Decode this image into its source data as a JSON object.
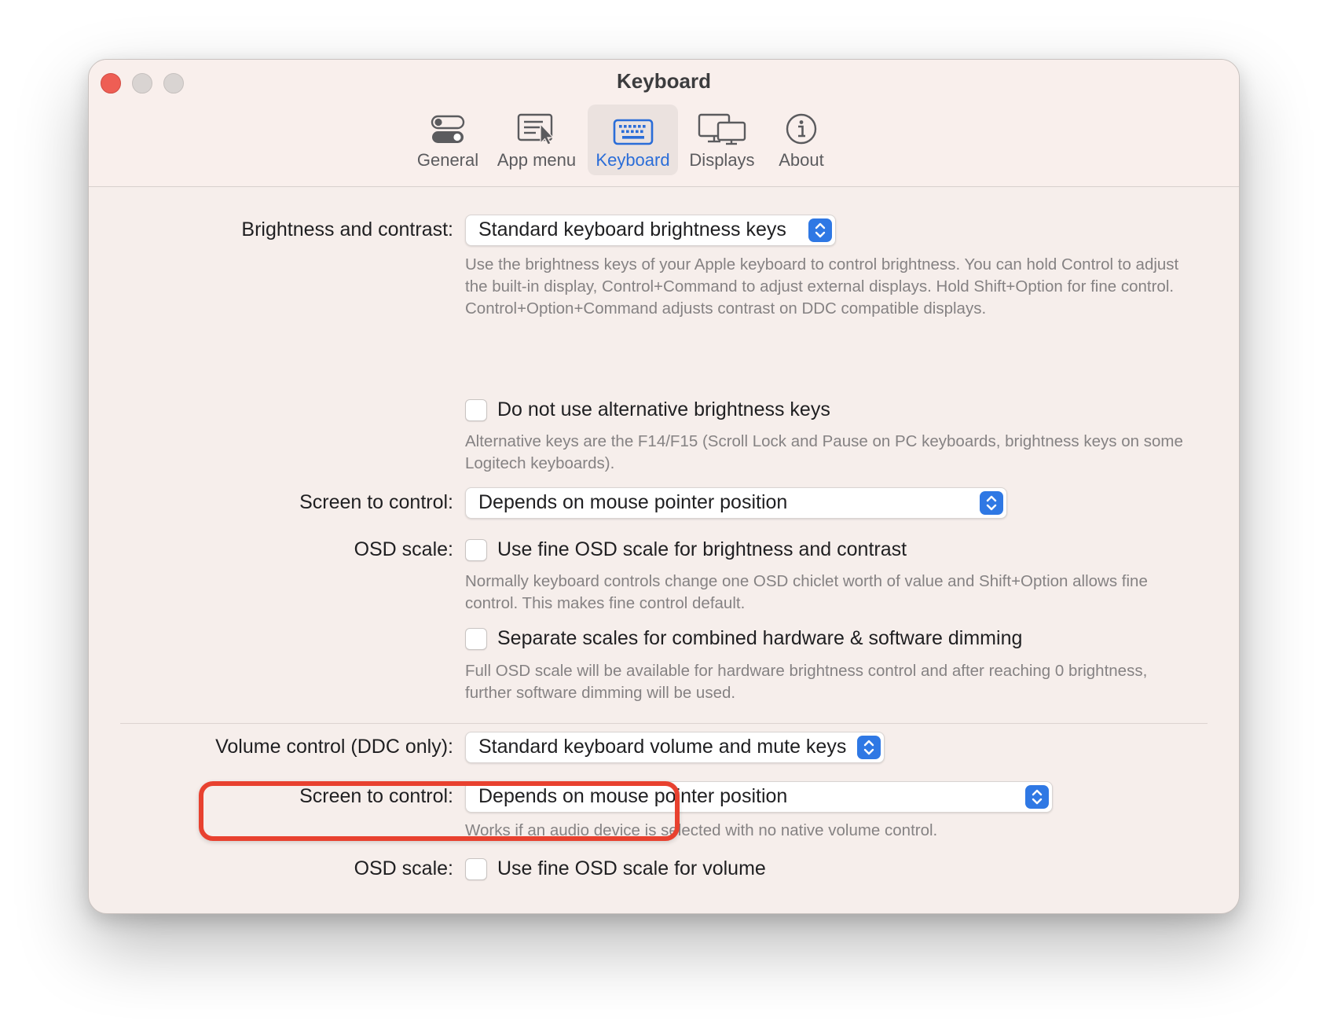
{
  "window": {
    "title": "Keyboard"
  },
  "tabs": [
    {
      "label": "General",
      "icon": "toggles-icon"
    },
    {
      "label": "App menu",
      "icon": "menu-cursor-icon"
    },
    {
      "label": "Keyboard",
      "icon": "keyboard-icon",
      "selected": true
    },
    {
      "label": "Displays",
      "icon": "displays-icon"
    },
    {
      "label": "About",
      "icon": "info-icon"
    }
  ],
  "colors": {
    "accent": "#2f78e4",
    "highlight": "#e8412f",
    "window_bg": "#f6eeeb"
  },
  "brightness": {
    "label": "Brightness and contrast:",
    "value": "Standard keyboard brightness keys",
    "description": "Use the brightness keys of your Apple keyboard to control brightness. You can hold Control to adjust the built-in display, Control+Command to adjust external displays. Hold Shift+Option for fine control. Control+Option+Command adjusts contrast on DDC compatible displays.",
    "alt_keys": {
      "label": "Do not use alternative brightness keys",
      "checked": false,
      "description": "Alternative keys are the F14/F15 (Scroll Lock and Pause on PC keyboards, brightness keys on some Logitech keyboards)."
    },
    "screen": {
      "label": "Screen to control:",
      "value": "Depends on mouse pointer position"
    },
    "osd": {
      "label": "OSD scale:",
      "fine": {
        "label": "Use fine OSD scale for brightness and contrast",
        "checked": false,
        "description": "Normally keyboard controls change one OSD chiclet worth of value and Shift+Option allows fine control. This makes fine control default."
      },
      "separate": {
        "label": "Separate scales for combined hardware & software dimming",
        "checked": false,
        "description": "Full OSD scale will be available for hardware brightness control and after reaching 0 brightness, further software dimming will be used."
      }
    }
  },
  "volume": {
    "label": "Volume control (DDC only):",
    "value": "Standard keyboard volume and mute keys",
    "screen": {
      "label": "Screen to control:",
      "value": "Depends on mouse pointer position",
      "description": "Works if an audio device is selected with no native volume control."
    },
    "osd": {
      "label": "OSD scale:",
      "fine_label": "Use fine OSD scale for volume",
      "checked": false
    }
  }
}
